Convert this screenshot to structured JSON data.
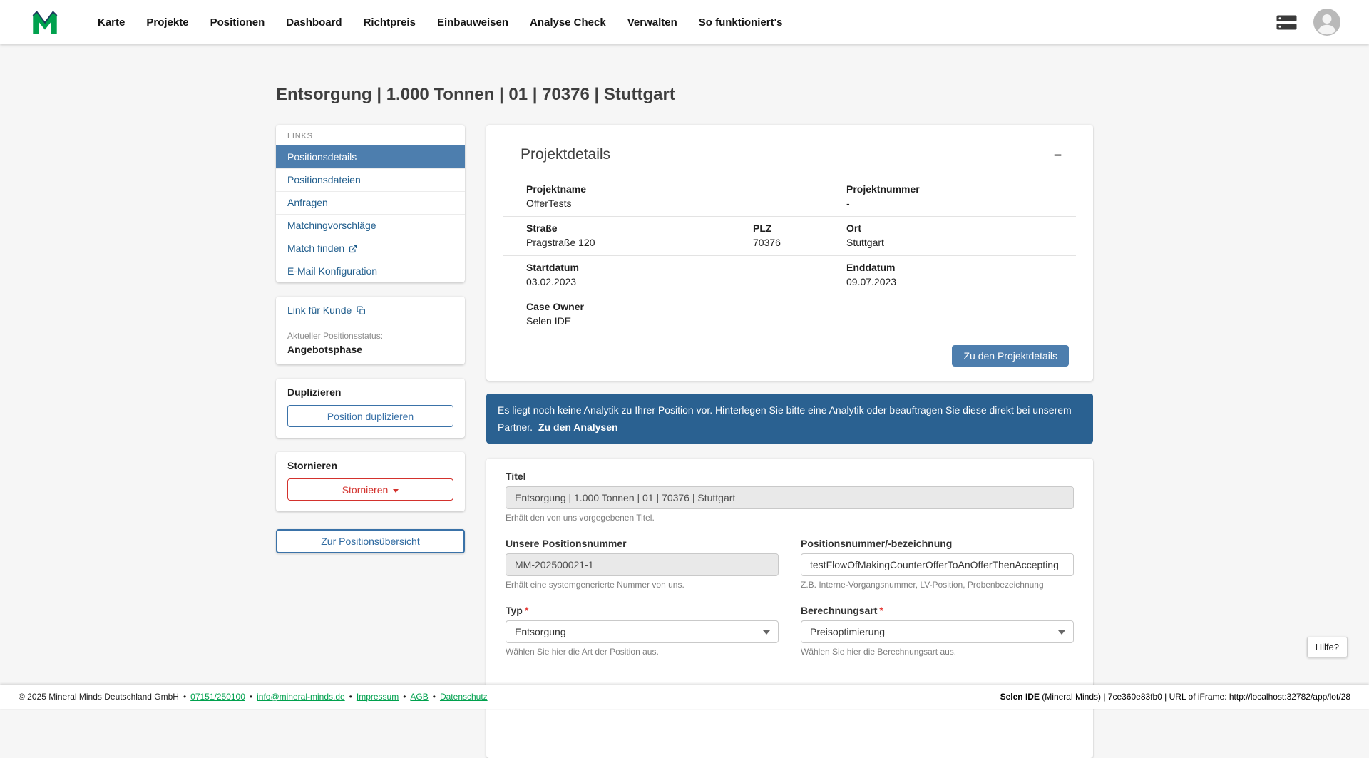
{
  "colors": {
    "primary": "#4d7eae",
    "link": "#215e8d",
    "banner": "#2a6191",
    "danger": "#d3322d",
    "brand_green": "#00a14e"
  },
  "icons": {
    "collapse": "−",
    "caret": "▾",
    "copy": "⧉",
    "external": "↗",
    "server": "▤",
    "avatar": "👤"
  },
  "nav": {
    "items": [
      "Karte",
      "Projekte",
      "Positionen",
      "Dashboard",
      "Richtpreis",
      "Einbauweisen",
      "Analyse Check",
      "Verwalten",
      "So funktioniert's"
    ]
  },
  "page": {
    "title": "Entsorgung | 1.000 Tonnen | 01 | 70376 | Stuttgart"
  },
  "sidebar": {
    "links_header": "LINKS",
    "items": [
      {
        "label": "Positionsdetails"
      },
      {
        "label": "Positionsdateien"
      },
      {
        "label": "Anfragen"
      },
      {
        "label": "Matchingvorschläge"
      },
      {
        "label": "Match finden"
      },
      {
        "label": "E-Mail Konfiguration"
      }
    ],
    "customer_link": "Link für Kunde",
    "status_label": "Aktueller Positionsstatus:",
    "status_value": "Angebotsphase",
    "duplicate_header": "Duplizieren",
    "duplicate_button": "Position duplizieren",
    "cancel_header": "Stornieren",
    "cancel_button": "Stornieren",
    "overview_button": "Zur Positionsübersicht"
  },
  "project_details": {
    "title": "Projektdetails",
    "projektname_label": "Projektname",
    "projektname": "OfferTests",
    "projektnummer_label": "Projektnummer",
    "projektnummer": "-",
    "strasse_label": "Straße",
    "strasse": "Pragstraße 120",
    "plz_label": "PLZ",
    "plz": "70376",
    "ort_label": "Ort",
    "ort": "Stuttgart",
    "startdatum_label": "Startdatum",
    "startdatum": "03.02.2023",
    "enddatum_label": "Enddatum",
    "enddatum": "09.07.2023",
    "case_owner_label": "Case Owner",
    "case_owner": "Selen IDE",
    "button": "Zu den Projektdetails"
  },
  "banner": {
    "text": "Es liegt noch keine Analytik zu Ihrer Position vor. Hinterlegen Sie bitte eine Analytik oder beauftragen Sie diese direkt bei unserem Partner.",
    "link": "Zu den Analysen"
  },
  "form": {
    "required_mark": "*",
    "titel_label": "Titel",
    "titel_value": "Entsorgung | 1.000 Tonnen | 01 | 70376 | Stuttgart",
    "titel_help": "Erhält den von uns vorgegebenen Titel.",
    "posnr_label": "Unsere Positionsnummer",
    "posnr_value": "MM-202500021-1",
    "posnr_help": "Erhält eine systemgenerierte Nummer von uns.",
    "bezeichnung_label": "Positionsnummer/-bezeichnung",
    "bezeichnung_value": "testFlowOfMakingCounterOfferToAnOfferThenAccepting",
    "bezeichnung_help": "Z.B. Interne-Vorgangsnummer, LV-Position, Probenbezeichnung",
    "typ_label": "Typ",
    "typ_value": "Entsorgung",
    "typ_help": "Wählen Sie hier die Art der Position aus.",
    "berechnungsart_label": "Berechnungsart",
    "berechnungsart_value": "Preisoptimierung",
    "berechnungsart_help": "Wählen Sie hier die Berechnungsart aus."
  },
  "help_button": "Hilfe?",
  "footer": {
    "copyright": "© 2025 Mineral Minds Deutschland GmbH",
    "separator": "•",
    "phone": "07151/250100",
    "email": "info@mineral-minds.de",
    "impressum": "Impressum",
    "agb": "AGB",
    "datenschutz": "Datenschutz",
    "user": "Selen IDE",
    "right_rest": " (Mineral Minds) | 7ce360e83fb0 | URL of iFrame: http://localhost:32782/app/lot/28"
  }
}
